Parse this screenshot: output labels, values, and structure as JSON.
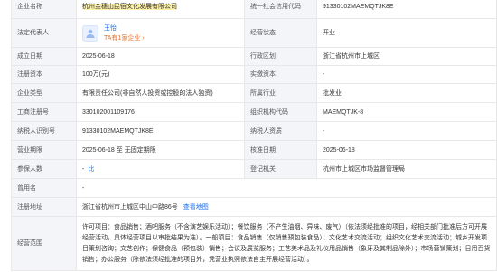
{
  "rows": {
    "r1": {
      "l1": "企业名称",
      "v1": "杭州金穗山民宿文化发展有限公司",
      "l2": "统一社会信用代码",
      "v2": "91330102MAEMQTJK8E"
    },
    "r2": {
      "l1": "法定代表人",
      "rep_name": "王怡",
      "rep_company": "TA有1家企业",
      "rep_arrow": "›",
      "l2": "经营状态",
      "v2": "开业"
    },
    "r3": {
      "l1": "成立日期",
      "v1": "2025-06-18",
      "l2": "行政区划",
      "v2": "浙江省杭州市上城区"
    },
    "r4": {
      "l1": "注册资本",
      "v1": "100万(元)",
      "l2": "实缴资本",
      "v2": "-"
    },
    "r5": {
      "l1": "企业类型",
      "v1": "有限责任公司(非自然人投资或控股的法人独资)",
      "l2": "所属行业",
      "v2": "批发业"
    },
    "r6": {
      "l1": "工商注册号",
      "v1": "330102001109176",
      "l2": "组织机构代码",
      "v2": "MAEMQTJK-8"
    },
    "r7": {
      "l1": "纳税人识别号",
      "v1": "91330102MAEMQTJK8E",
      "l2": "纳税人资质",
      "v2": "-"
    },
    "r8": {
      "l1": "营业期限",
      "v1": "2025-06-18 至 无固定期限",
      "l2": "核准日期",
      "v2": "2025-06-18"
    },
    "r9": {
      "l1": "参保人数",
      "v1": "-",
      "v1_link": "比",
      "l2": "登记机关",
      "v2": "杭州市上城区市场监督管理局"
    },
    "r10": {
      "l1": "曾用名",
      "v1": "-"
    },
    "r11": {
      "l1": "注册地址",
      "v1": "浙江省杭州市上城区中山中路86号",
      "link": "查看地图"
    },
    "r12": {
      "l1": "经营范围",
      "v1": "许可项目：食品销售；酒吧服务（不含演艺娱乐活动）；餐饮服务（不产生油烟、异味、废气）（依法须经批准的项目，经相关部门批准后方可开展经营活动，具体经营项目以审批结果为准）。一般项目：食品销售（仅销售预包装食品）；文化艺术交流活动；组织文化艺术交流活动；城乡开发项目策划咨询；文艺创作；保健食品（预包装）销售；会议及展览服务；工艺美术品及礼仪用品销售（象牙及其制品除外）；市场营销策划；日用百货销售；办公服务（除依法须经批准的项目外，凭营业执照依法自主开展经营活动）。"
    }
  },
  "colors": {
    "label_bg": "#f3f5f9",
    "border": "#e8e8e8",
    "link": "#1a6ef0",
    "highlight": "#fff2a8",
    "orange": "#e8702a"
  },
  "icons": {
    "avatar": "person-avatar-icon"
  }
}
